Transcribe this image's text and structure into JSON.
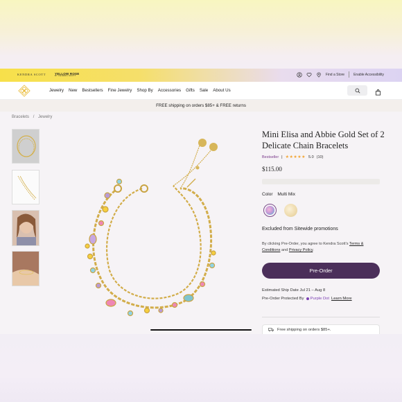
{
  "topbar": {
    "brand_primary": "KENDRA SCOTT",
    "brand_secondary": "YELLOW ROSE",
    "brand_secondary_sub": "BY KENDRA SCOTT",
    "find_store": "Find a Store",
    "accessibility": "Enable Accessibility"
  },
  "nav": {
    "items": [
      "Jewelry",
      "New",
      "Bestsellers",
      "Fine Jewelry",
      "Shop By",
      "Accessories",
      "Gifts",
      "Sale",
      "About Us"
    ]
  },
  "banner": {
    "text": "FREE shipping on orders $85+ & FREE returns"
  },
  "breadcrumb": [
    "Bracelets",
    "/",
    "Jewelry"
  ],
  "product": {
    "title": "Mini Elisa and Abbie Gold Set of 2 Delicate Chain Bracelets",
    "badge": "Bestseller",
    "badge_sep": "|",
    "stars": "★★★★★",
    "rating": "5.0",
    "review_count": "(10)",
    "price": "$115.00",
    "color_label": "Color",
    "color_value": "Multi Mix",
    "excluded": "Excluded from Sitewide promotions",
    "legal_prefix": "By clicking Pre-Order, you agree to Kendra Scott's ",
    "legal_terms": "Terms & Conditions",
    "legal_and": " and ",
    "legal_privacy": "Privacy Policy",
    "legal_end": ".",
    "cta": "Pre-Order",
    "ship_date": "Estimated Ship Date Jul 21 – Aug 8",
    "protected_prefix": "Pre-Order Protected By",
    "protected_brand": "Purple Dot",
    "learn_more": "Learn More",
    "free_shipping_card": "Free shipping on orders $85+."
  },
  "colors": {
    "accent": "#4b2f5a",
    "bestseller": "#7a3a8a",
    "star": "#f2a533",
    "purple_dot": "#7b3fb3"
  },
  "icons": [
    "account-icon",
    "heart-icon",
    "location-pin-icon",
    "search-icon",
    "shopping-bag-icon",
    "truck-icon"
  ]
}
